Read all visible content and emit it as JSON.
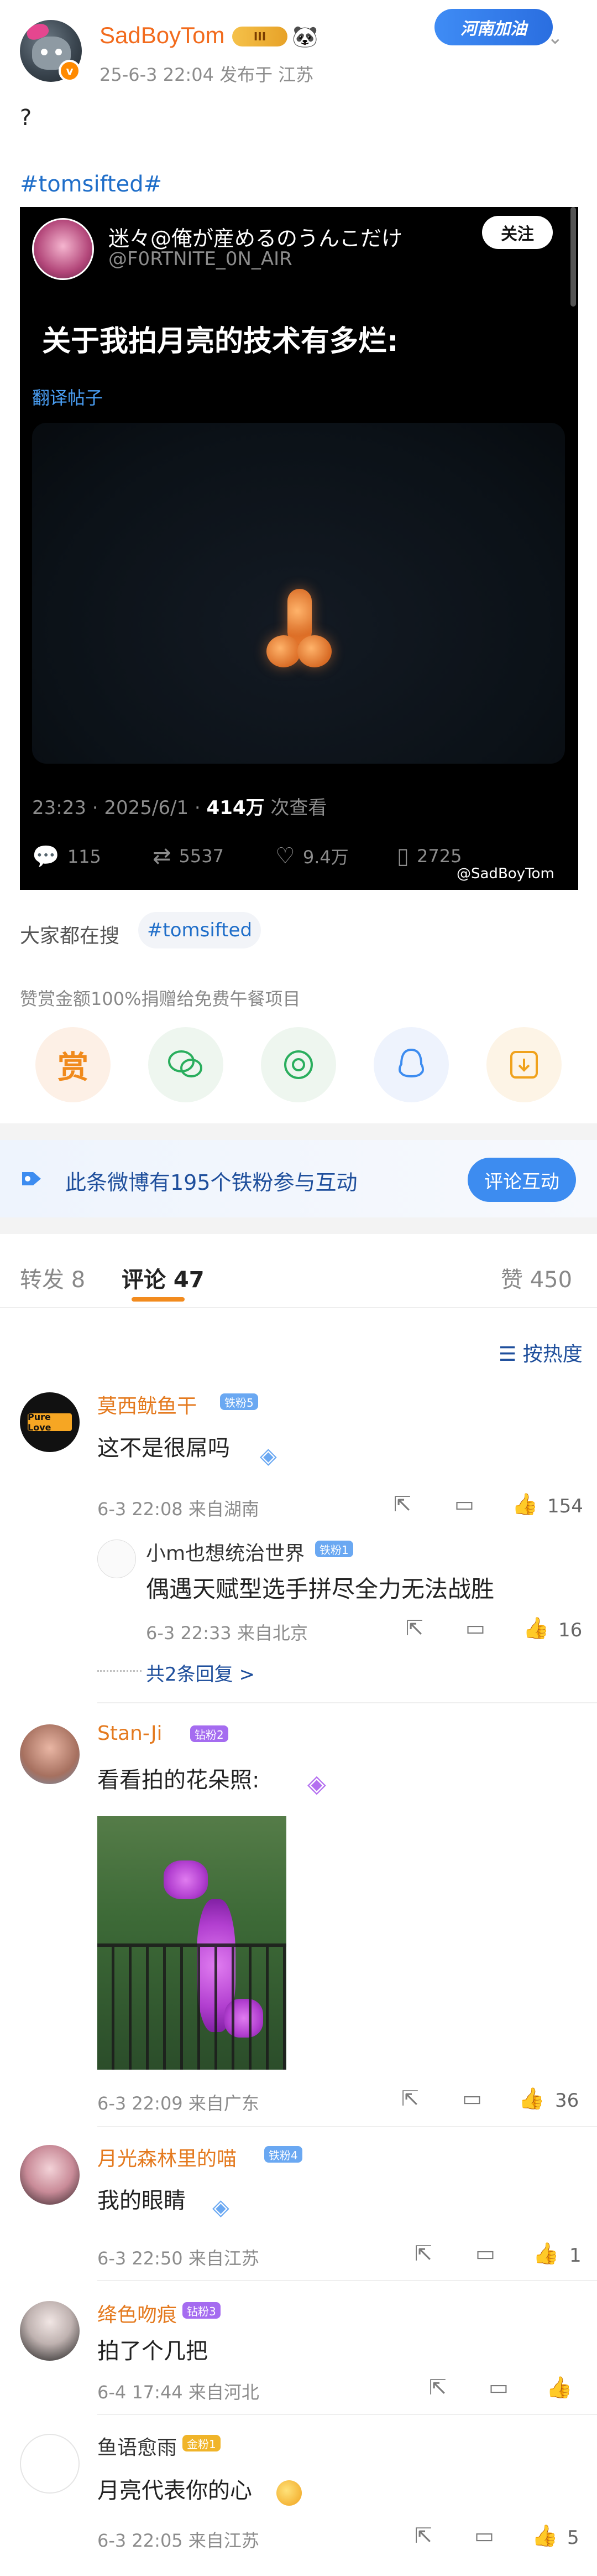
{
  "post": {
    "username": "SadBoyTom",
    "level_badge": "III",
    "meta": "25-6-3 22:04  发布于 江苏",
    "sticker_text": "河南加油",
    "text": "?",
    "hashtag": "#tomsifted#"
  },
  "tweet": {
    "name": "迷々@俺が産めるのうんこだけ",
    "handle": "@F0RTNITE_0N_AIR",
    "follow_label": "关注",
    "body": "关于我拍月亮的技术有多烂:",
    "translate_label": "翻译帖子",
    "time": "23:23 · 2025/6/1 · ",
    "views": "414万",
    "views_suffix": " 次查看",
    "replies": "115",
    "retweets": "5537",
    "likes": "9.4万",
    "bookmarks": "2725",
    "watermark": "@SadBoyTom"
  },
  "search": {
    "label": "大家都在搜",
    "chip": "#tomsifted"
  },
  "donate_note": "赞赏金额100%捐赠给免费午餐项目",
  "share_icons": [
    "reward-icon",
    "wechat-icon",
    "moments-icon",
    "qq-icon",
    "save-image-icon"
  ],
  "banner": {
    "text": "此条微博有195个铁粉参与互动",
    "button": "评论互动"
  },
  "tabs": {
    "repost": "转发 8",
    "comments": "评论 47",
    "likes": "赞 450"
  },
  "sort_label": "按热度",
  "comments": [
    {
      "name": "莫西鱿鱼干",
      "badge": "铁粉5",
      "avatar_text": "Pure Love",
      "text": "这不是很屌吗",
      "meta": "6-3 22:08  来自湖南",
      "likes": "154",
      "replies": [
        {
          "name": "小m也想统治世界",
          "badge": "铁粉1",
          "text": "偶遇天赋型选手拼尽全力无法战胜",
          "meta": "6-3 22:33  来自北京",
          "likes": "16"
        }
      ],
      "more_replies": "共2条回复 >"
    },
    {
      "name": "Stan-Ji",
      "badge": "钻粉2",
      "text": "看看拍的花朵照:",
      "meta": "6-3 22:09  来自广东",
      "likes": "36"
    },
    {
      "name": "月光森林里的喵",
      "badge": "铁粉4",
      "text": "我的眼睛",
      "meta": "6-3 22:50  来自江苏",
      "likes": "1"
    },
    {
      "name": "绛色吻痕",
      "badge": "钻粉3",
      "text": "拍了个几把",
      "meta": "6-4 17:44  来自河北",
      "likes": ""
    },
    {
      "name": "鱼语愈雨",
      "badge": "金粉1",
      "text": "月亮代表你的心",
      "meta": "6-3 22:05  来自江苏",
      "likes": "5"
    }
  ],
  "colors": {
    "link_blue": "#1f6ec9",
    "name_orange": "#e47a1f",
    "accent_orange": "#f28b1e",
    "button_blue": "#3d8cf0"
  }
}
